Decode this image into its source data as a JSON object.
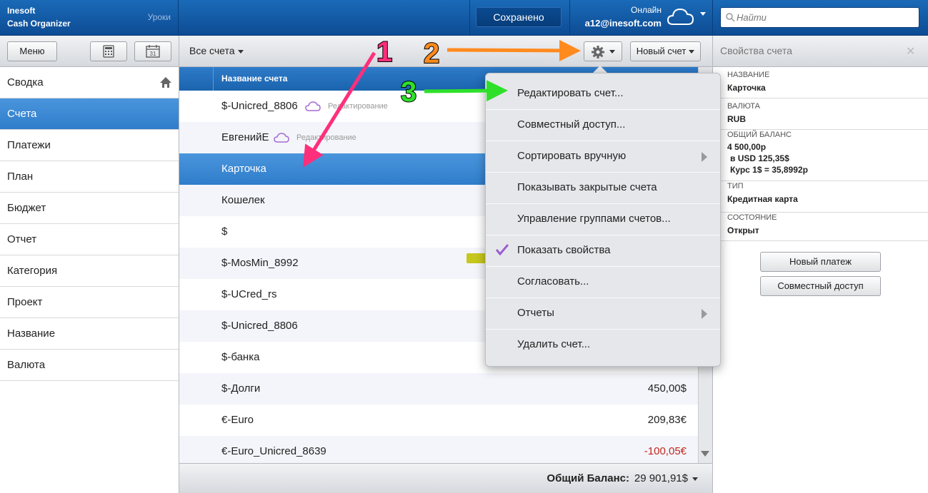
{
  "brand": {
    "line1": "Inesoft",
    "line2": "Cash Organizer",
    "lessons": "Уроки"
  },
  "top": {
    "saved": "Сохранено",
    "status": "Онлайн",
    "email": "a12@inesoft.com",
    "search_placeholder": "Найти"
  },
  "toolbar": {
    "menu": "Меню",
    "calendar_day": "31",
    "all_accounts": "Все счета",
    "new_account": "Новый счет",
    "props_title": "Свойства счета",
    "close": "✕"
  },
  "sidebar": [
    {
      "label": "Сводка"
    },
    {
      "label": "Счета"
    },
    {
      "label": "Платежи"
    },
    {
      "label": "План"
    },
    {
      "label": "Бюджет"
    },
    {
      "label": "Отчет"
    },
    {
      "label": "Категория"
    },
    {
      "label": "Проект"
    },
    {
      "label": "Название"
    },
    {
      "label": "Валюта"
    }
  ],
  "list": {
    "header": "Название счета",
    "rows": [
      {
        "name": "$-Unicred_8806",
        "amount": "",
        "edit": "Редактирование"
      },
      {
        "name": "ЕвгенийЕ",
        "amount": "",
        "edit": "Редактирование"
      },
      {
        "name": "Карточка",
        "amount": ""
      },
      {
        "name": "Кошелек",
        "amount": ""
      },
      {
        "name": "$",
        "amount": ""
      },
      {
        "name": "$-MosMin_8992",
        "amount": ""
      },
      {
        "name": "$-UCred_rs",
        "amount": ""
      },
      {
        "name": "$-Unicred_8806",
        "amount": ""
      },
      {
        "name": "$-банка",
        "amount": ""
      },
      {
        "name": "$-Долги",
        "amount": "450,00$"
      },
      {
        "name": "€-Euro",
        "amount": "209,83€"
      },
      {
        "name": "€-Euro_Unicred_8639",
        "amount": "-100,05€"
      }
    ],
    "total_label": "Общий Баланс:",
    "total_value": "29 901,91$"
  },
  "props": {
    "name_label": "НАЗВАНИЕ",
    "name_value": "Карточка",
    "currency_label": "ВАЛЮТА",
    "currency_value": "RUB",
    "balance_label": "ОБЩИЙ БАЛАНС",
    "balance_line1": "4 500,00р",
    "balance_line2": "в USD 125,35$",
    "balance_line3": "Курс 1$ = 35,8992р",
    "type_label": "ТИП",
    "type_value": "Кредитная карта",
    "state_label": "СОСТОЯНИЕ",
    "state_value": "Открыт",
    "new_payment": "Новый платеж",
    "shared_access": "Совместный доступ"
  },
  "dropdown": [
    {
      "label": "Редактировать счет..."
    },
    {
      "label": "Совместный доступ..."
    },
    {
      "label": "Сортировать вручную"
    },
    {
      "label": "Показывать закрытые счета"
    },
    {
      "label": "Управление группами счетов..."
    },
    {
      "label": "Показать свойства"
    },
    {
      "label": "Согласовать..."
    },
    {
      "label": "Отчеты"
    },
    {
      "label": "Удалить счет..."
    }
  ],
  "annotations": {
    "n1": "1",
    "n2": "2",
    "n3": "3"
  },
  "colors": {
    "accent": "#2f7dcb",
    "header": "#0d4c94",
    "negative": "#c0281e",
    "cloud": "#a46bd6",
    "arrow1": "#ff2f7b",
    "arrow2": "#ff8a1e",
    "arrow3": "#2fe02a"
  }
}
